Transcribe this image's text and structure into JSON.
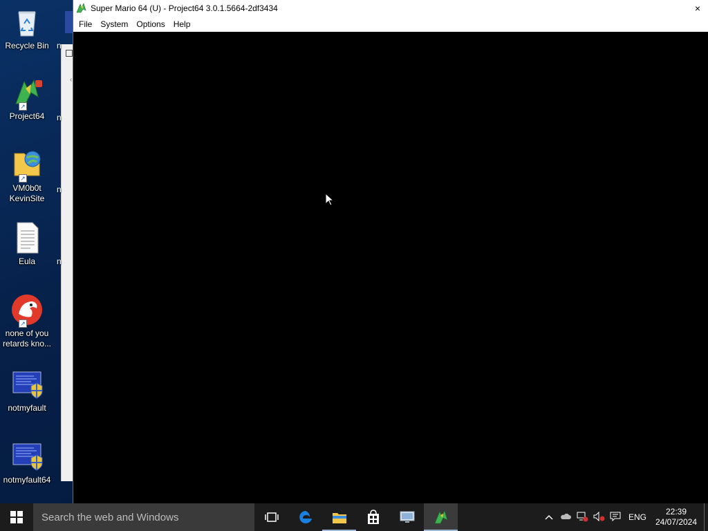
{
  "desktop": {
    "icons": [
      {
        "label": "Recycle Bin"
      },
      {
        "label": "Project64"
      },
      {
        "label": "VM0b0t\nKevinSite"
      },
      {
        "label": "Eula"
      },
      {
        "label": "none of you\nretards kno..."
      },
      {
        "label": "notmyfault"
      },
      {
        "label": "notmyfault64"
      }
    ],
    "peek_labels": [
      "n",
      "n",
      "n",
      "n"
    ]
  },
  "window": {
    "title": "Super Mario 64 (U) - Project64 3.0.1.5664-2df3434",
    "close": "×",
    "menu": [
      "File",
      "System",
      "Options",
      "Help"
    ]
  },
  "taskbar": {
    "search_placeholder": "Search the web and Windows",
    "apps": [
      "task-view",
      "edge",
      "file-explorer",
      "store",
      "remote-desktop",
      "project64"
    ],
    "tray": {
      "language": "ENG",
      "time": "22:39",
      "date": "24/07/2024"
    }
  },
  "colors": {
    "desktop": "#062048",
    "taskbar": "#1c1c1c",
    "search": "#3a3a3a",
    "content": "#000000"
  }
}
